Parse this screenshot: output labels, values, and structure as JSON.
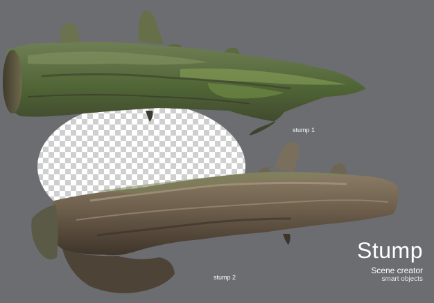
{
  "labels": {
    "stump1": "stump 1",
    "stump2": "stump 2"
  },
  "title_block": {
    "title": "Stump",
    "subtitle": "Scene creator",
    "tagline": "smart objects"
  },
  "colors": {
    "background": "#6b6d70",
    "checker_light": "#ffffff",
    "checker_dark": "#cfcfcf",
    "moss": "#5f7a3a",
    "bark_dark": "#4a3f33",
    "bark_light": "#8a7a66"
  }
}
